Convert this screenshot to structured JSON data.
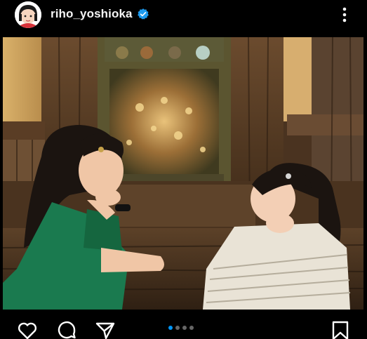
{
  "header": {
    "username": "riho_yoshioka",
    "verified": true
  },
  "post": {
    "image_icon": "photo",
    "carousel": {
      "count": 4,
      "active_index": 0
    }
  },
  "actions": {
    "like_icon": "heart-icon",
    "comment_icon": "comment-bubble-icon",
    "share_icon": "paper-plane-icon",
    "save_icon": "bookmark-icon"
  },
  "colors": {
    "background": "#000000",
    "text": "#ffffff",
    "verified_badge": "#1d9bf0",
    "carousel_active": "#0095f6",
    "carousel_inactive": "#666666"
  }
}
